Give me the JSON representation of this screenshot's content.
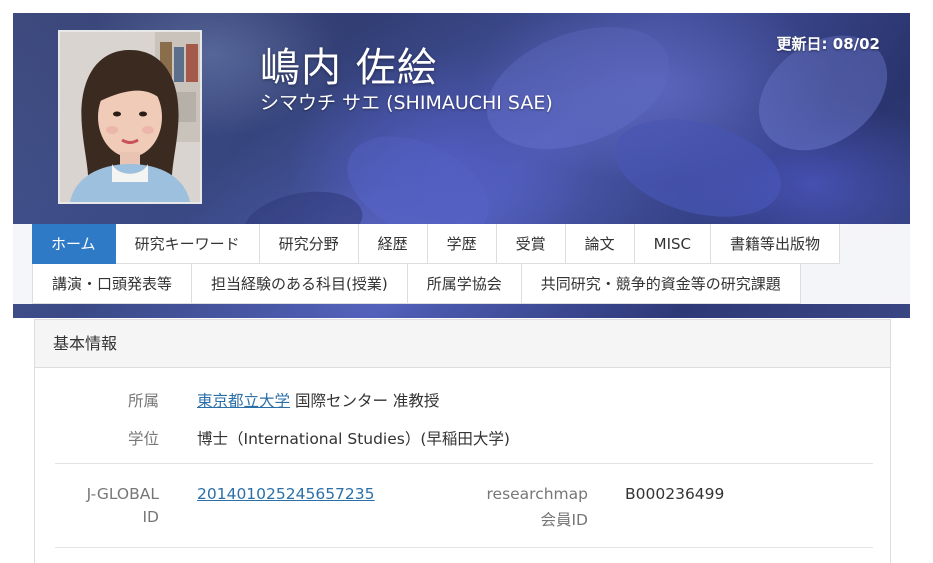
{
  "header": {
    "name_ja": "嶋内 佐絵",
    "name_kana": "シマウチ サエ  (SHIMAUCHI SAE)",
    "updated": "更新日: 08/02"
  },
  "tabs_row1": [
    "ホーム",
    "研究キーワード",
    "研究分野",
    "経歴",
    "学歴",
    "受賞",
    "論文",
    "MISC",
    "書籍等出版物"
  ],
  "tabs_row2": [
    "講演・口頭発表等",
    "担当経験のある科目(授業)",
    "所属学協会",
    "共同研究・競争的資金等の研究課題"
  ],
  "active_tab": "ホーム",
  "basic_info": {
    "title": "基本情報",
    "affiliation_label": "所属",
    "affiliation_link": "東京都立大学",
    "affiliation_rest": " 国際センター 准教授",
    "degree_label": "学位",
    "degree_value": "博士（International Studies）(早稲田大学)",
    "jglobal_label_1": "J-GLOBAL",
    "jglobal_label_2": "ID",
    "jglobal_value": "201401025245657235",
    "rmap_label_1": "researchmap",
    "rmap_label_2": "会員ID",
    "rmap_value": "B000236499"
  },
  "colors": {
    "active_tab": "#2e7ac6",
    "link": "#2b6fa8"
  }
}
